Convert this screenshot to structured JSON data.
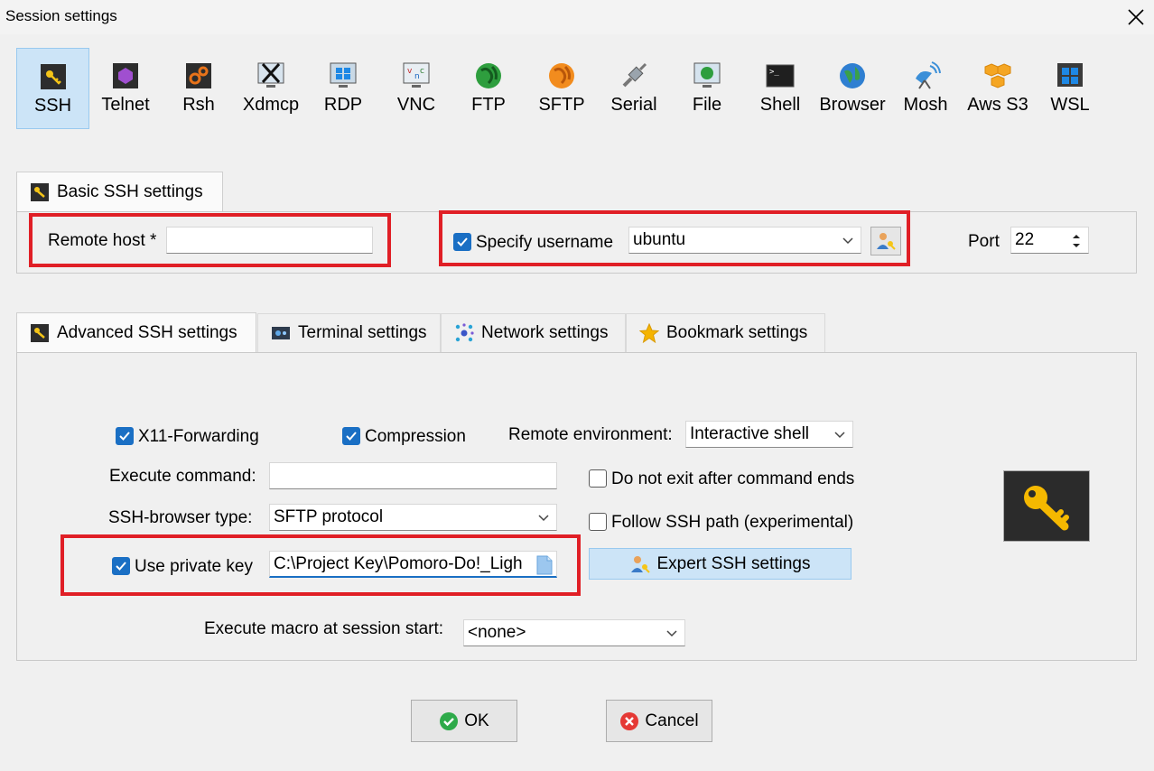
{
  "window": {
    "title": "Session settings"
  },
  "session_types": [
    {
      "label": "SSH",
      "icon": "ssh-icon"
    },
    {
      "label": "Telnet",
      "icon": "telnet-icon"
    },
    {
      "label": "Rsh",
      "icon": "rsh-icon"
    },
    {
      "label": "Xdmcp",
      "icon": "xdmcp-icon"
    },
    {
      "label": "RDP",
      "icon": "rdp-icon"
    },
    {
      "label": "VNC",
      "icon": "vnc-icon"
    },
    {
      "label": "FTP",
      "icon": "ftp-icon"
    },
    {
      "label": "SFTP",
      "icon": "sftp-icon"
    },
    {
      "label": "Serial",
      "icon": "serial-icon"
    },
    {
      "label": "File",
      "icon": "file-icon"
    },
    {
      "label": "Shell",
      "icon": "shell-icon"
    },
    {
      "label": "Browser",
      "icon": "browser-icon"
    },
    {
      "label": "Mosh",
      "icon": "mosh-icon"
    },
    {
      "label": "Aws S3",
      "icon": "aws-s3-icon"
    },
    {
      "label": "WSL",
      "icon": "wsl-icon"
    }
  ],
  "basic": {
    "tab_label": "Basic SSH settings",
    "remote_host_label": "Remote host *",
    "remote_host_value": "",
    "specify_username_label": "Specify username",
    "specify_username_checked": true,
    "username_value": "ubuntu",
    "port_label": "Port",
    "port_value": "22"
  },
  "tabs": [
    {
      "label": "Advanced SSH settings",
      "icon": "wrench-icon",
      "active": true
    },
    {
      "label": "Terminal settings",
      "icon": "terminal-icon",
      "active": false
    },
    {
      "label": "Network settings",
      "icon": "network-icon",
      "active": false
    },
    {
      "label": "Bookmark settings",
      "icon": "star-icon",
      "active": false
    }
  ],
  "advanced": {
    "x11_label": "X11-Forwarding",
    "x11_checked": true,
    "compression_label": "Compression",
    "compression_checked": true,
    "remote_env_label": "Remote environment:",
    "remote_env_value": "Interactive shell",
    "execute_command_label": "Execute command:",
    "execute_command_value": "",
    "do_not_exit_label": "Do not exit after command ends",
    "do_not_exit_checked": false,
    "ssh_browser_label": "SSH-browser type:",
    "ssh_browser_value": "SFTP protocol",
    "follow_path_label": "Follow SSH path (experimental)",
    "follow_path_checked": false,
    "private_key_label": "Use private key",
    "private_key_checked": true,
    "private_key_value": "C:\\Project Key\\Pomoro-Do!_Ligh",
    "expert_button_label": "Expert SSH settings",
    "macro_label": "Execute macro at session start:",
    "macro_value": "<none>"
  },
  "footer": {
    "ok_label": "OK",
    "cancel_label": "Cancel"
  },
  "colors": {
    "highlight": "#e01f26",
    "accent": "#1a6fc4",
    "selected_bg": "#cce4f7"
  }
}
